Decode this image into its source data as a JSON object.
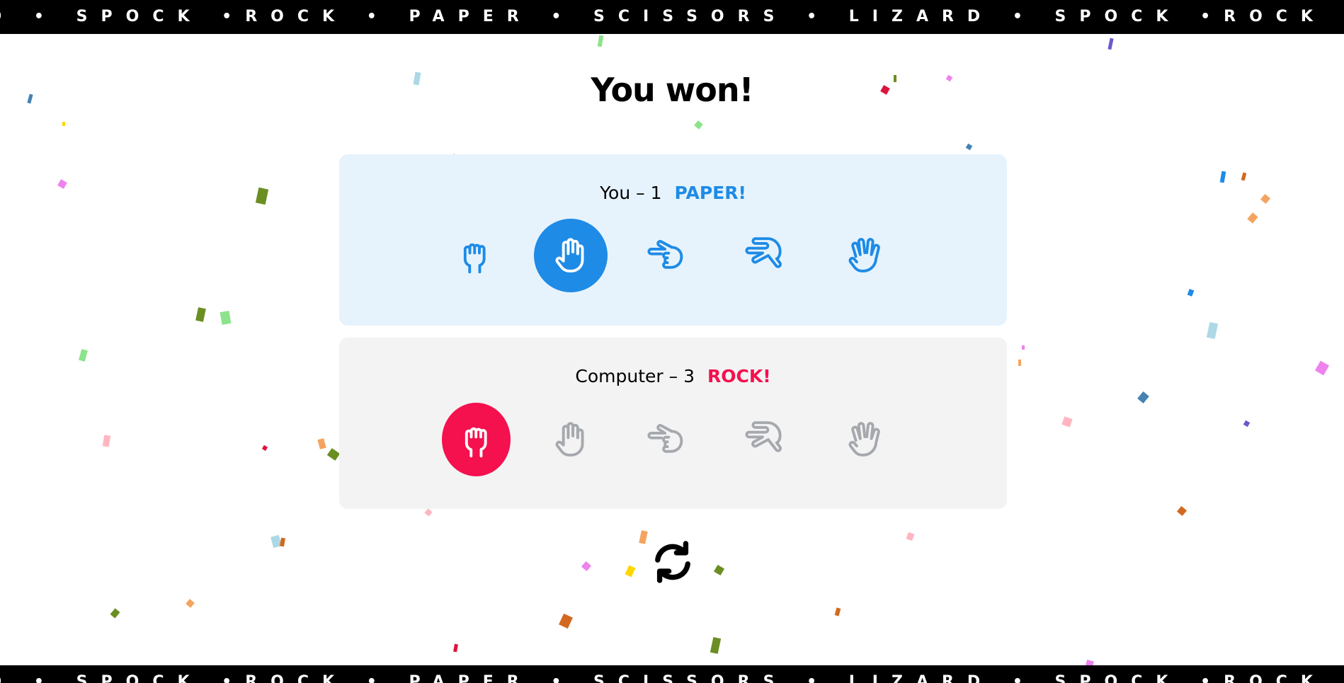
{
  "marquee": {
    "text": "D • SPOCK •ROCK • PAPER • SCISSORS • LIZARD • SPOCK •ROCK • PA"
  },
  "title": "You won!",
  "player": {
    "label": "You – 1",
    "choice": "PAPER!",
    "accent_color": "#1e8be6",
    "background": "#e6f3fd",
    "selected": "paper",
    "hands": [
      {
        "id": "rock",
        "icon": "rock-fist-icon"
      },
      {
        "id": "paper",
        "icon": "paper-hand-icon"
      },
      {
        "id": "scissors",
        "icon": "scissors-hand-icon"
      },
      {
        "id": "lizard",
        "icon": "lizard-hand-icon"
      },
      {
        "id": "spock",
        "icon": "spock-hand-icon"
      }
    ]
  },
  "computer": {
    "label": "Computer – 3",
    "choice": "ROCK!",
    "accent_color": "#f5104e",
    "background": "#f3f3f3",
    "selected": "rock",
    "hands": [
      {
        "id": "rock",
        "icon": "rock-fist-icon"
      },
      {
        "id": "paper",
        "icon": "paper-hand-icon"
      },
      {
        "id": "scissors",
        "icon": "scissors-hand-icon"
      },
      {
        "id": "lizard",
        "icon": "lizard-hand-icon"
      },
      {
        "id": "spock",
        "icon": "spock-hand-icon"
      }
    ]
  },
  "reset_icon": "refresh-icon"
}
